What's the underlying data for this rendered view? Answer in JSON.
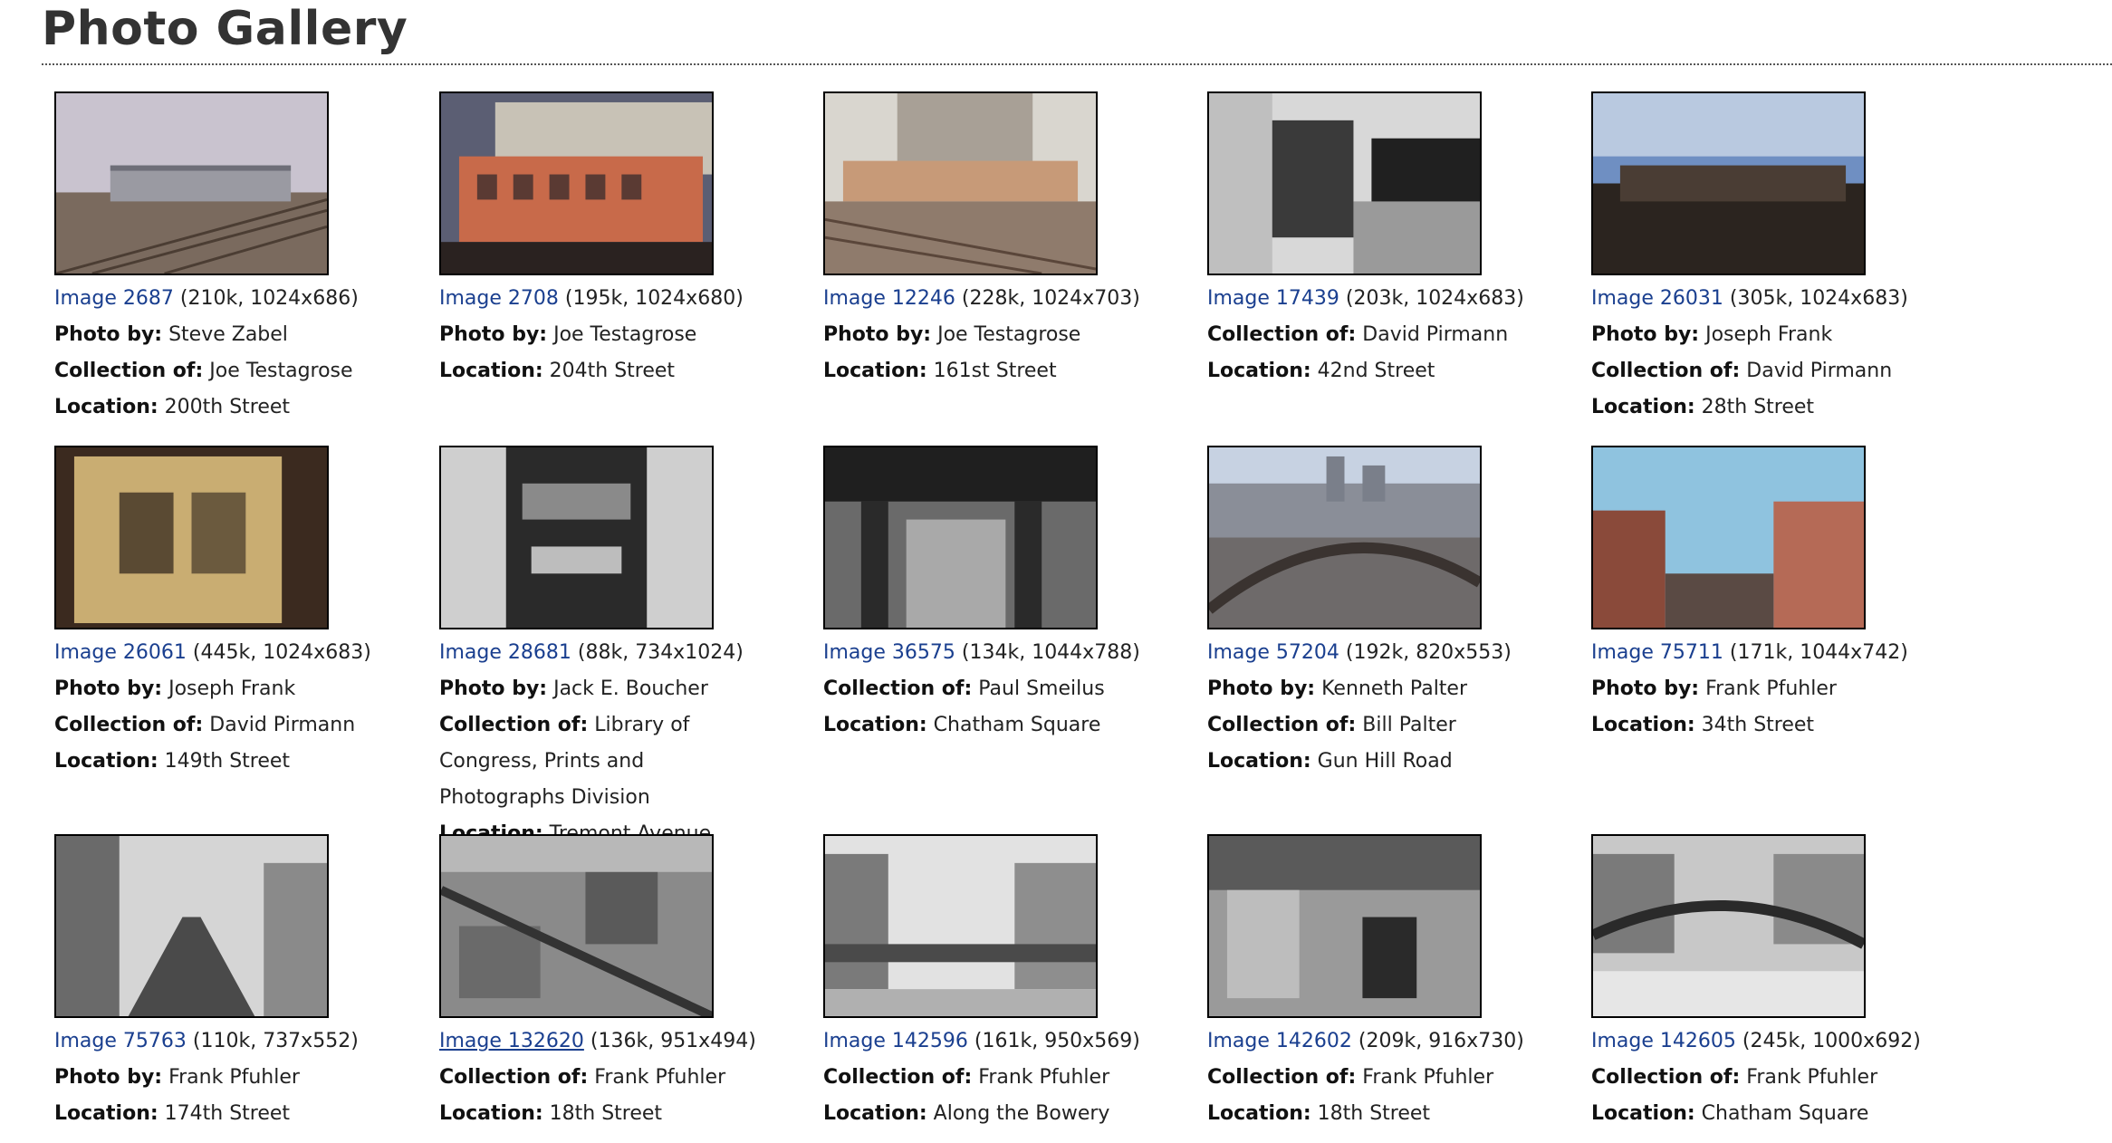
{
  "page": {
    "title": "Photo Gallery"
  },
  "colors": {
    "link": "#1a3f8f",
    "text": "#222222",
    "title": "#333333"
  },
  "labels": {
    "photo_by": "Photo by:",
    "collection_of": "Collection of:",
    "location": "Location:"
  },
  "photos": [
    {
      "link": "Image 2687",
      "meta": "(210k, 1024x686)",
      "photo_by": "Steve Zabel",
      "collection_of": "Joe Testagrose",
      "location": "200th Street"
    },
    {
      "link": "Image 2708",
      "meta": "(195k, 1024x680)",
      "photo_by": "Joe Testagrose",
      "location": "204th Street"
    },
    {
      "link": "Image 12246",
      "meta": "(228k, 1024x703)",
      "photo_by": "Joe Testagrose",
      "location": "161st Street"
    },
    {
      "link": "Image 17439",
      "meta": "(203k, 1024x683)",
      "collection_of": "David Pirmann",
      "location": "42nd Street"
    },
    {
      "link": "Image 26031",
      "meta": "(305k, 1024x683)",
      "photo_by": "Joseph Frank",
      "collection_of": "David Pirmann",
      "location": "28th Street"
    },
    {
      "link": "Image 26061",
      "meta": "(445k, 1024x683)",
      "photo_by": "Joseph Frank",
      "collection_of": "David Pirmann",
      "location": "149th Street"
    },
    {
      "link": "Image 28681",
      "meta": "(88k, 734x1024)",
      "photo_by": "Jack E. Boucher",
      "collection_of": "Library of Congress, Prints and Photographs Division",
      "location": "Tremont Avenue"
    },
    {
      "link": "Image 36575",
      "meta": "(134k, 1044x788)",
      "collection_of": "Paul Smeilus",
      "location": "Chatham Square"
    },
    {
      "link": "Image 57204",
      "meta": "(192k, 820x553)",
      "photo_by": "Kenneth Palter",
      "collection_of": "Bill Palter",
      "location": "Gun Hill Road"
    },
    {
      "link": "Image 75711",
      "meta": "(171k, 1044x742)",
      "photo_by": "Frank Pfuhler",
      "location": "34th Street"
    },
    {
      "link": "Image 75763",
      "meta": "(110k, 737x552)",
      "photo_by": "Frank Pfuhler",
      "location": "174th Street"
    },
    {
      "link": "Image 132620",
      "meta": "(136k, 951x494)",
      "collection_of": "Frank Pfuhler",
      "location": "18th Street"
    },
    {
      "link": "Image 142596",
      "meta": "(161k, 950x569)",
      "collection_of": "Frank Pfuhler",
      "location": "Along the Bowery"
    },
    {
      "link": "Image 142602",
      "meta": "(209k, 916x730)",
      "collection_of": "Frank Pfuhler",
      "location": "18th Street"
    },
    {
      "link": "Image 142605",
      "meta": "(245k, 1000x692)",
      "collection_of": "Frank Pfuhler",
      "location": "Chatham Square"
    }
  ]
}
